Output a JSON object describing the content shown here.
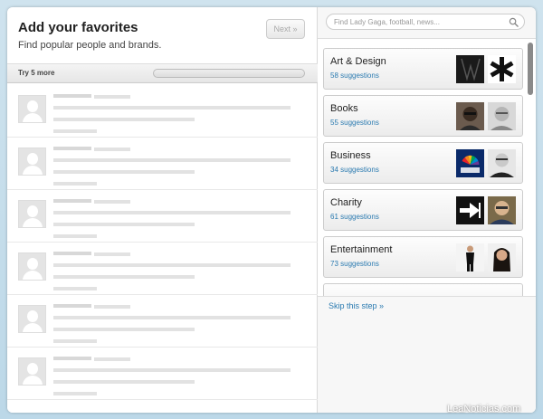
{
  "header": {
    "title": "Add your favorites",
    "subtitle": "Find popular people and brands.",
    "next_label": "Next »"
  },
  "try_bar": {
    "label": "Try 5 more",
    "progress": 0
  },
  "placeholder_rows": 6,
  "search": {
    "placeholder": "Find Lady Gaga, football, news..."
  },
  "categories": [
    {
      "name": "Art & Design",
      "count": "58 suggestions"
    },
    {
      "name": "Books",
      "count": "55 suggestions"
    },
    {
      "name": "Business",
      "count": "34 suggestions"
    },
    {
      "name": "Charity",
      "count": "61 suggestions"
    },
    {
      "name": "Entertainment",
      "count": "73 suggestions"
    }
  ],
  "skip_label": "Skip this step »",
  "watermark": "LeaNoticias.com",
  "colors": {
    "link": "#2a7ab0",
    "background": "#cfe3ee"
  }
}
